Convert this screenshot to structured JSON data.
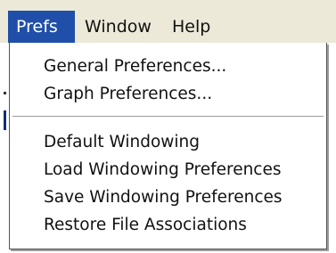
{
  "menubar": {
    "items": [
      {
        "label": "Prefs",
        "active": true
      },
      {
        "label": "Window",
        "active": false
      },
      {
        "label": "Help",
        "active": false
      }
    ]
  },
  "prefs_menu": {
    "items": [
      {
        "label": "General Preferences..."
      },
      {
        "label": "Graph Preferences..."
      },
      {
        "label": "Default Windowing"
      },
      {
        "label": "Load Windowing Preferences"
      },
      {
        "label": "Save Windowing Preferences"
      },
      {
        "label": "Restore File Associations"
      }
    ]
  },
  "colors": {
    "menubar_background": "#ece9d8",
    "highlight": "#1f4fa8",
    "menu_background": "#ffffff",
    "text": "#111111"
  }
}
